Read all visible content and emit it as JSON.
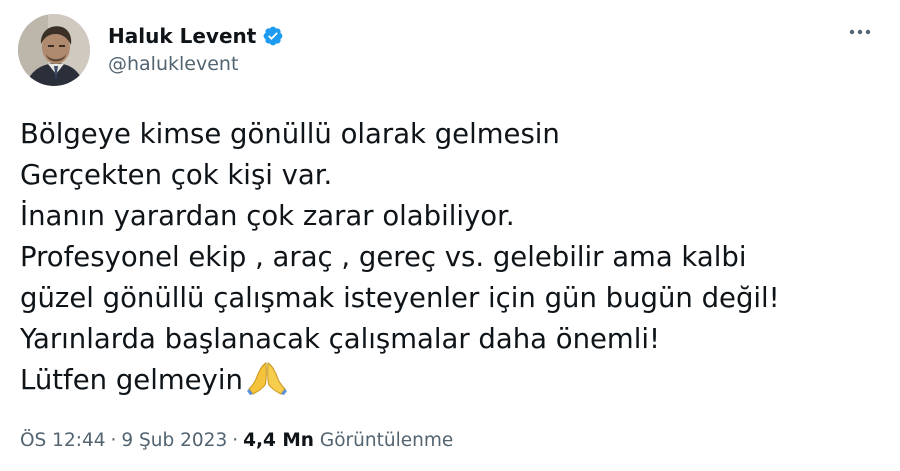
{
  "author": {
    "display_name": "Haluk Levent",
    "handle": "@haluklevent",
    "verified": true,
    "verified_color": "#1d9bf0"
  },
  "more_icon": "more-horizontal-icon",
  "tweet": {
    "lines": [
      "Bölgeye kimse gönüllü olarak gelmesin",
      "Gerçekten çok kişi var.",
      "İnanın yarardan çok zarar olabiliyor.",
      "Profesyonel ekip , araç , gereç vs. gelebilir ama kalbi",
      "güzel gönüllü çalışmak isteyenler için gün bugün değil!",
      "Yarınlarda başlanacak çalışmalar daha önemli!",
      "Lütfen gelmeyin"
    ],
    "emoji": "folded-hands-emoji"
  },
  "meta": {
    "time": "ÖS 12:44",
    "separator": "·",
    "date": "9 Şub 2023",
    "views_count": "4,4 Mn",
    "views_label": "Görüntülenme"
  },
  "colors": {
    "text": "#0f1419",
    "secondary": "#536471",
    "background": "#ffffff"
  }
}
